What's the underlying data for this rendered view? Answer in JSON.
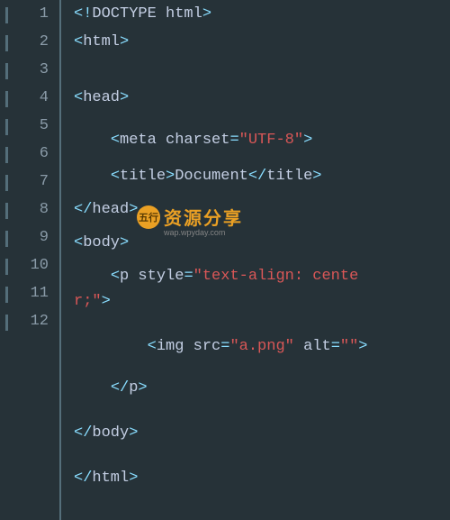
{
  "lineHeight": 31,
  "gutter": {
    "numbers": [
      "1",
      "2",
      "3",
      "4",
      "5",
      "6",
      "7",
      "8",
      "9",
      "10",
      "11",
      "12"
    ],
    "foldMarks": [
      1,
      2,
      3,
      4,
      5,
      6,
      7,
      8,
      9,
      10,
      11,
      12
    ]
  },
  "code": {
    "rows": [
      {
        "y": 0,
        "indent": 0,
        "tokens": [
          [
            "punct",
            "<!"
          ],
          [
            "tag",
            "DOCTYPE html"
          ],
          [
            "punct",
            ">"
          ]
        ]
      },
      {
        "y": 1,
        "indent": 0,
        "tokens": [
          [
            "punct",
            "<"
          ],
          [
            "tag",
            "html"
          ],
          [
            "punct",
            ">"
          ]
        ]
      },
      {
        "y": 3,
        "indent": 0,
        "tokens": [
          [
            "punct",
            "<"
          ],
          [
            "tag",
            "head"
          ],
          [
            "punct",
            ">"
          ]
        ]
      },
      {
        "y": 4.5,
        "indent": 1,
        "tokens": [
          [
            "punct",
            "<"
          ],
          [
            "tag",
            "meta "
          ],
          [
            "attr",
            "charset"
          ],
          [
            "punct",
            "="
          ],
          [
            "str",
            "\"UTF-8\""
          ],
          [
            "punct",
            ">"
          ]
        ]
      },
      {
        "y": 5.8,
        "indent": 1,
        "tokens": [
          [
            "punct",
            "<"
          ],
          [
            "tag",
            "title"
          ],
          [
            "punct",
            ">"
          ],
          [
            "text",
            "Document"
          ],
          [
            "punct",
            "</"
          ],
          [
            "tag",
            "title"
          ],
          [
            "punct",
            ">"
          ]
        ]
      },
      {
        "y": 7,
        "indent": 0,
        "tokens": [
          [
            "punct",
            "</"
          ],
          [
            "tag",
            "head"
          ],
          [
            "punct",
            ">"
          ]
        ]
      },
      {
        "y": 8.2,
        "indent": 0,
        "tokens": [
          [
            "punct",
            "<"
          ],
          [
            "tag",
            "body"
          ],
          [
            "punct",
            ">"
          ]
        ]
      },
      {
        "y": 9.4,
        "indent": 1,
        "tokens": [
          [
            "punct",
            "<"
          ],
          [
            "tag",
            "p "
          ],
          [
            "attr",
            "style"
          ],
          [
            "punct",
            "="
          ],
          [
            "str",
            "\"text-align: cente"
          ]
        ]
      },
      {
        "y": 10.3,
        "indent": 0,
        "tokens": [
          [
            "str",
            "r;\""
          ],
          [
            "punct",
            ">"
          ]
        ]
      },
      {
        "y": 11.9,
        "indent": 2,
        "tokens": [
          [
            "punct",
            "<"
          ],
          [
            "tag",
            "img "
          ],
          [
            "attr",
            "src"
          ],
          [
            "punct",
            "="
          ],
          [
            "str",
            "\"a.png\""
          ],
          [
            "tag",
            " "
          ],
          [
            "attr",
            "alt"
          ],
          [
            "punct",
            "="
          ],
          [
            "str",
            "\"\""
          ],
          [
            "punct",
            ">"
          ]
        ]
      },
      {
        "y": 13.4,
        "indent": 1,
        "tokens": [
          [
            "punct",
            "</"
          ],
          [
            "tag",
            "p"
          ],
          [
            "punct",
            ">"
          ]
        ]
      },
      {
        "y": 15,
        "indent": 0,
        "tokens": [
          [
            "punct",
            "</"
          ],
          [
            "tag",
            "body"
          ],
          [
            "punct",
            ">"
          ]
        ]
      },
      {
        "y": 16.6,
        "indent": 0,
        "tokens": [
          [
            "punct",
            "</"
          ],
          [
            "tag",
            "html"
          ],
          [
            "punct",
            ">"
          ]
        ]
      }
    ]
  },
  "watermark": {
    "badge": "五行",
    "text": "资源分享",
    "sub": "wap.wpyday.com"
  }
}
